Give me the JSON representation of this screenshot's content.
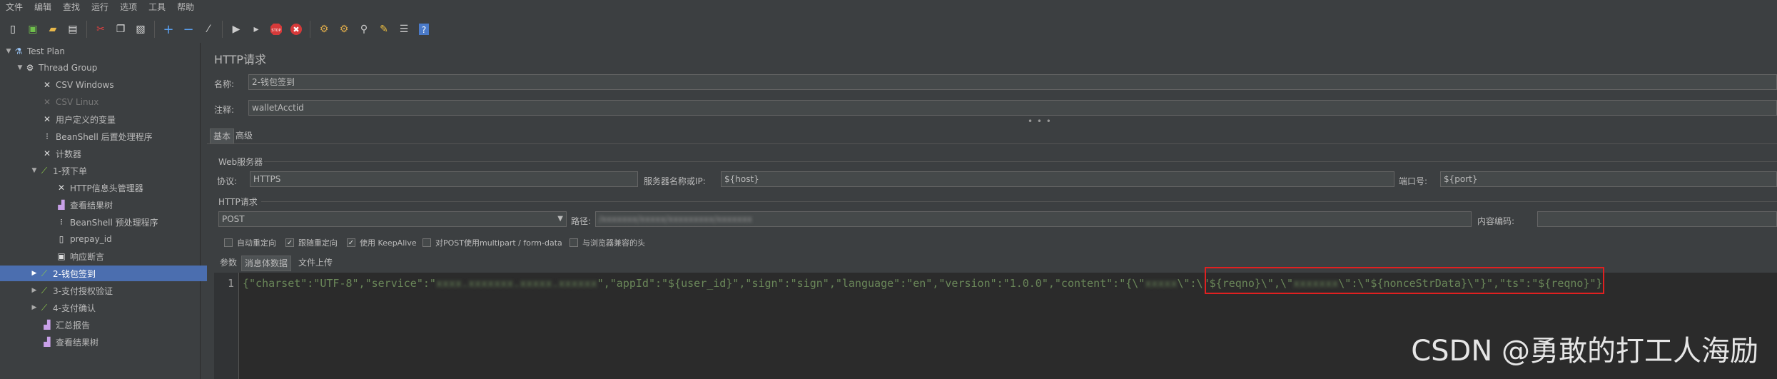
{
  "menu": [
    "文件",
    "编辑",
    "查找",
    "运行",
    "选项",
    "工具",
    "帮助"
  ],
  "toolbar_icons": [
    "new-icon",
    "template-icon",
    "open-icon",
    "save-icon",
    "cut-icon",
    "copy-icon",
    "paste-icon",
    "add-icon",
    "remove-icon",
    "browse-icon",
    "start-icon",
    "start-no-pause-icon",
    "stop-icon",
    "shutdown-icon",
    "clear-icon",
    "clear-all-icon",
    "search-icon",
    "reset-search-icon",
    "function-helper-icon",
    "help-icon"
  ],
  "tree": {
    "items": [
      {
        "label": "Test Plan",
        "icon": "flask-icon"
      },
      {
        "label": "Thread Group",
        "icon": "gear-icon"
      },
      {
        "label": "CSV Windows",
        "icon": "config-icon"
      },
      {
        "label": "CSV Linux",
        "icon": "config-icon"
      },
      {
        "label": "用户定义的变量",
        "icon": "config-icon"
      },
      {
        "label": "BeanShell 后置处理程序",
        "icon": "postprocessor-icon"
      },
      {
        "label": "计数器",
        "icon": "config-icon"
      },
      {
        "label": "1-预下单",
        "icon": "sampler-icon"
      },
      {
        "label": "HTTP信息头管理器",
        "icon": "config-icon"
      },
      {
        "label": "查看结果树",
        "icon": "listener-icon"
      },
      {
        "label": "BeanShell 预处理程序",
        "icon": "preprocessor-icon"
      },
      {
        "label": "prepay_id",
        "icon": "extractor-icon"
      },
      {
        "label": "响应断言",
        "icon": "assertion-icon"
      },
      {
        "label": "2-钱包签到",
        "icon": "sampler-icon"
      },
      {
        "label": "3-支付授权验证",
        "icon": "sampler-icon"
      },
      {
        "label": "4-支付确认",
        "icon": "sampler-icon"
      },
      {
        "label": "汇总报告",
        "icon": "listener-icon"
      },
      {
        "label": "查看结果树",
        "icon": "listener-icon"
      }
    ]
  },
  "panel": {
    "title": "HTTP请求",
    "name_label": "名称:",
    "name_value": "2-钱包签到",
    "comment_label": "注释:",
    "comment_value": "walletAcctid",
    "tab_basic": "基本",
    "tab_advanced": "高级",
    "web_server_section": "Web服务器",
    "protocol_label": "协议:",
    "protocol_value": "HTTPS",
    "server_label": "服务器名称或IP:",
    "server_value": "${host}",
    "port_label": "端口号:",
    "port_value": "${port}",
    "http_request_section": "HTTP请求",
    "method_value": "POST",
    "path_label": "路径:",
    "path_value": "/xxxxxxx/xxxxx/xxxxxxxxx/xxxxxxx",
    "encoding_label": "内容编码:",
    "encoding_value": "",
    "checkboxes": [
      {
        "label": "自动重定向",
        "checked": false
      },
      {
        "label": "跟随重定向",
        "checked": true
      },
      {
        "label": "使用 KeepAlive",
        "checked": true
      },
      {
        "label": "对POST使用multipart / form-data",
        "checked": false
      },
      {
        "label": "与浏览器兼容的头",
        "checked": false
      }
    ],
    "subtab_params": "参数",
    "subtab_body": "消息体数据",
    "subtab_files": "文件上传"
  },
  "editor": {
    "line_number": "1",
    "code_part1": "{\"charset\":\"UTF-8\",\"service\":\"",
    "code_blur1": "xxxx.xxxxxxx.xxxxx.xxxxxx",
    "code_part2": "\",\"appId\":\"${user_id}\",\"sign\":\"sign\",\"language\":\"en\",\"version\":\"1.0.0\",\"content\":",
    "code_part3": "\"{\\\"",
    "code_blur2": "xxxxx",
    "code_part4": "\\\":\\\"${reqno}\\\",\\\"",
    "code_blur3": "xxxxxxx",
    "code_part5": "\\\":\\\"${nonceStrData}\\\"}\",\"ts\":\"${reqno}\"}"
  },
  "watermark": "CSDN @勇敢的打工人海励",
  "colors": {
    "selection": "#4b6eaf",
    "highlight": "#e02020",
    "background": "#3c3f41"
  }
}
